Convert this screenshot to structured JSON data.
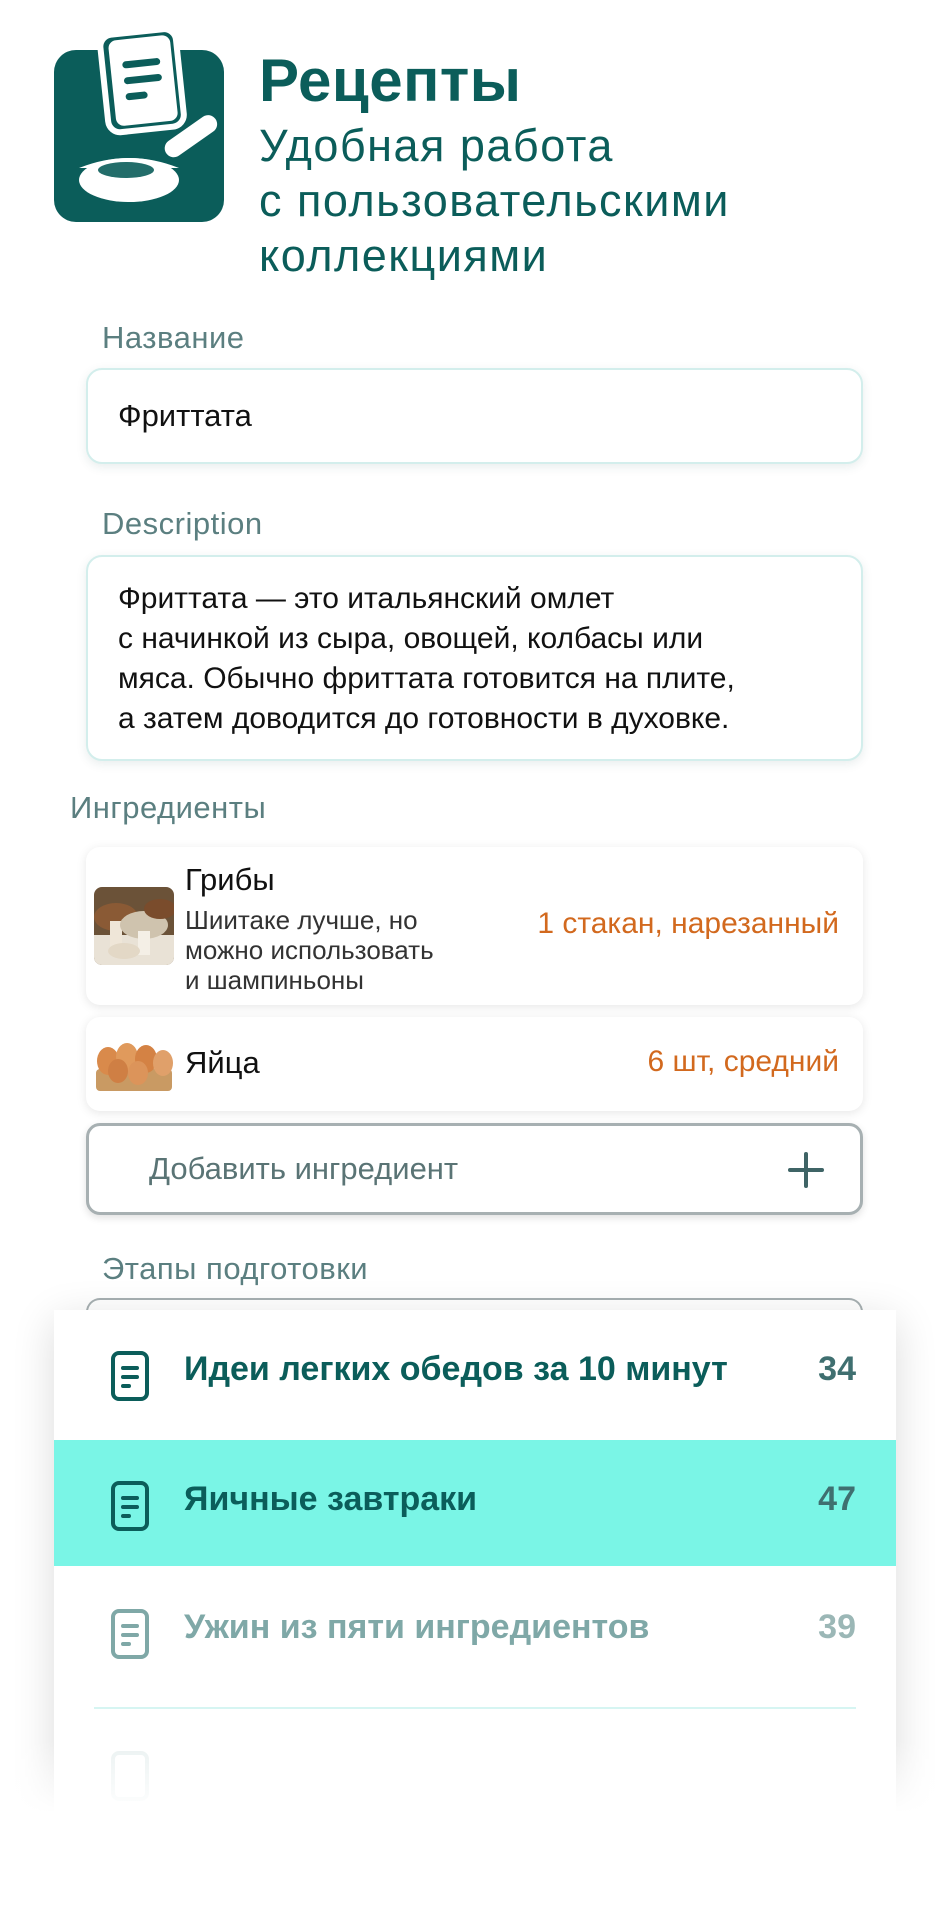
{
  "header": {
    "title": "Рецепты",
    "subtitle_lines": [
      "Удобная работа",
      "с пользовательскими",
      "коллекциями"
    ]
  },
  "form": {
    "name_label": "Название",
    "name_value": "Фриттата",
    "description_label": "Description",
    "description_lines": [
      "Фриттата — это итальянский омлет",
      "с начинкой из сыра, овощей, колбасы или",
      "мяса. Обычно фриттата готовится на плите,",
      "а затем доводится до готовности в духовке."
    ],
    "ingredients_label": "Ингредиенты",
    "ingredients": [
      {
        "name": "Грибы",
        "note_lines": [
          "Шиитаке лучше, но",
          "можно использовать",
          "и шампиньоны"
        ],
        "quantity": "1 стакан, нарезанный",
        "image": "mushrooms-photo"
      },
      {
        "name": "Яйца",
        "quantity": "6 шт, средний",
        "image": "eggs-photo"
      }
    ],
    "add_ingredient_label": "Добавить ингредиент",
    "add_icon": "plus-icon",
    "steps_label": "Этапы подготовки"
  },
  "collections": [
    {
      "title": "Идеи легких обедов за 10 минут",
      "count": "34",
      "state": "normal"
    },
    {
      "title": "Яичные завтраки",
      "count": "47",
      "state": "selected"
    },
    {
      "title": "Ужин из пяти ингредиентов",
      "count": "39",
      "state": "dim"
    }
  ],
  "colors": {
    "brand": "#0b5d5a",
    "accent_selected": "#7af5e6",
    "quantity": "#d2691e",
    "label": "#5b7f80"
  }
}
